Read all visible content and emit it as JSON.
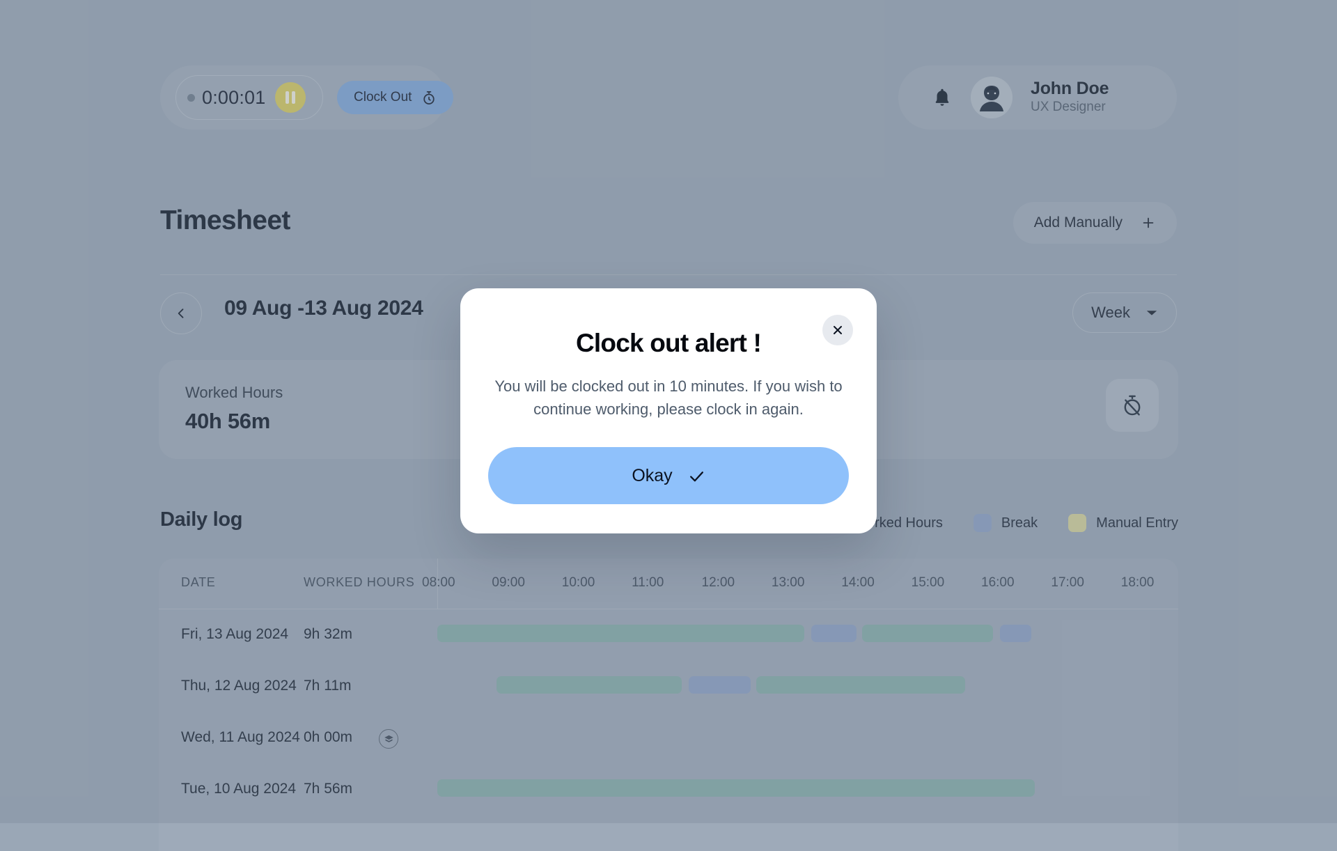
{
  "topbar": {
    "timer_value": "0:00:01",
    "pause_icon": "pause-icon",
    "clock_out_label": "Clock Out",
    "stopwatch_icon": "stopwatch-icon",
    "bell_icon": "bell-icon",
    "user_name": "John Doe",
    "user_role": "UX Designer"
  },
  "header": {
    "title": "Timesheet",
    "add_manually_label": "Add Manually",
    "add_icon": "plus-icon"
  },
  "nav": {
    "prev_icon": "chevron-left-icon",
    "range": "09 Aug -13 Aug 2024",
    "period_label": "Week",
    "period_icon": "chevron-down-icon"
  },
  "summary": {
    "label": "Worked Hours",
    "value": "40h 56m",
    "icon": "stopwatch-off-icon"
  },
  "daily_log": {
    "title": "Daily log",
    "legend": [
      {
        "label": "Worked Hours",
        "color": "#86AEA9"
      },
      {
        "label": "Break",
        "color": "#8DA1C4"
      },
      {
        "label": "Manual Entry",
        "color": "#D6D39A"
      }
    ],
    "columns": {
      "date": "DATE",
      "worked_hours": "WORKED HOURS"
    },
    "time_ticks": [
      "08:00",
      "09:00",
      "10:00",
      "11:00",
      "12:00",
      "13:00",
      "14:00",
      "15:00",
      "16:00",
      "17:00",
      "18:00"
    ],
    "rows": [
      {
        "date": "Fri, 13 Aug 2024",
        "worked": "9h 32m",
        "badge": null,
        "segments": [
          {
            "type": "work",
            "start": 8.0,
            "end": 13.25
          },
          {
            "type": "break",
            "start": 13.35,
            "end": 14.0
          },
          {
            "type": "work",
            "start": 14.08,
            "end": 15.95
          },
          {
            "type": "break",
            "start": 16.05,
            "end": 16.5
          }
        ]
      },
      {
        "date": "Thu, 12 Aug 2024",
        "worked": "7h 11m",
        "badge": null,
        "segments": [
          {
            "type": "work",
            "start": 8.85,
            "end": 11.5
          },
          {
            "type": "break",
            "start": 11.6,
            "end": 12.48
          },
          {
            "type": "work",
            "start": 12.56,
            "end": 15.55
          }
        ]
      },
      {
        "date": "Wed, 11 Aug 2024",
        "worked": "0h 00m",
        "badge": "holiday-icon",
        "segments": []
      },
      {
        "date": "Tue, 10 Aug 2024",
        "worked": "7h 56m",
        "badge": null,
        "segments": [
          {
            "type": "work",
            "start": 8.0,
            "end": 16.55
          }
        ]
      }
    ]
  },
  "modal": {
    "title": "Clock out alert !",
    "body": "You will be clocked out in 10 minutes. If you wish to continue working, please clock in again.",
    "ok_label": "Okay",
    "ok_icon": "check-icon",
    "close_icon": "close-icon"
  },
  "colors": {
    "background": "#9AA7B6",
    "accent_blue": "#7FA6D8",
    "modal_button": "#8FC1FB",
    "work": "#86AEA9",
    "break": "#8DA1C4",
    "manual": "#D6D39A",
    "pause": "#D8CC5C"
  }
}
